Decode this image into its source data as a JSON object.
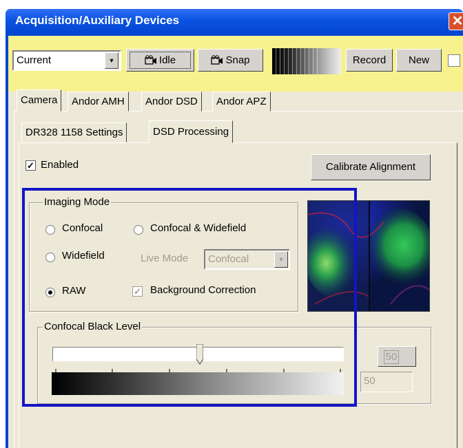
{
  "window": {
    "title": "Acquisition/Auxiliary Devices",
    "close_glyph": "✕"
  },
  "toolbar": {
    "preset_value": "Current",
    "idle_label": "Idle",
    "snap_label": "Snap",
    "record_label": "Record",
    "new_label": "New"
  },
  "tabs": [
    "Camera",
    "Andor AMH",
    "Andor DSD",
    "Andor APZ"
  ],
  "subtabs": [
    "DR328 1158 Settings",
    "DSD Processing"
  ],
  "dsd": {
    "enabled_label": "Enabled",
    "enabled_checked": true,
    "calibrate_label": "Calibrate Alignment",
    "imaging_mode": {
      "legend": "Imaging Mode",
      "confocal": "Confocal",
      "confocal_widefield": "Confocal & Widefield",
      "widefield": "Widefield",
      "raw": "RAW",
      "selected": "RAW",
      "live_mode_label": "Live Mode",
      "live_mode_value": "Confocal",
      "background_correction": "Background Correction",
      "background_correction_checked": true
    },
    "black_level": {
      "legend": "Confocal Black Level",
      "value": 50,
      "button_value": "50",
      "field_value": "50"
    }
  },
  "colors": {
    "titlebar": "#0a52e0",
    "toolbar": "#f7f18e",
    "highlight": "#1414c8",
    "face": "#ece9d8"
  },
  "icons": {
    "camera": "camera-icon",
    "close": "close-icon",
    "dropdown": "chevron-down-icon"
  }
}
